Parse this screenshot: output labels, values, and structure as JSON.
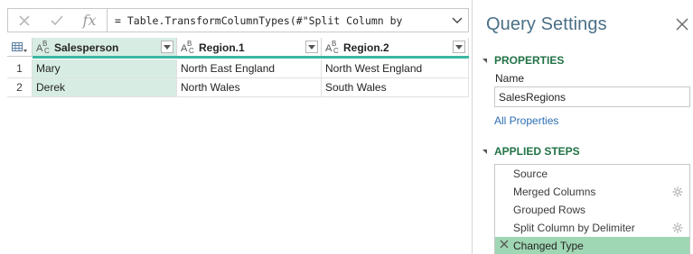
{
  "formula_bar": {
    "cancel_icon": "close-icon",
    "commit_icon": "checkmark-icon",
    "fx_label": "fx",
    "formula": "= Table.TransformColumnTypes(#\"Split Column by"
  },
  "grid": {
    "columns": [
      {
        "type_icon": "text-type-icon",
        "label": "Salesperson"
      },
      {
        "type_icon": "text-type-icon",
        "label": "Region.1"
      },
      {
        "type_icon": "text-type-icon",
        "label": "Region.2"
      }
    ],
    "rows": [
      {
        "num": "1",
        "cells": [
          "Mary",
          "North East England",
          "North West England"
        ]
      },
      {
        "num": "2",
        "cells": [
          "Derek",
          "North Wales",
          "South Wales"
        ]
      }
    ]
  },
  "settings": {
    "title": "Query Settings",
    "properties_header": "PROPERTIES",
    "name_label": "Name",
    "name_value": "SalesRegions",
    "all_properties": "All Properties",
    "applied_steps_header": "APPLIED STEPS",
    "steps": [
      {
        "label": "Source",
        "has_gear": false
      },
      {
        "label": "Merged Columns",
        "has_gear": true
      },
      {
        "label": "Grouped Rows",
        "has_gear": false
      },
      {
        "label": "Split Column by Delimiter",
        "has_gear": true
      },
      {
        "label": "Changed Type",
        "has_gear": false,
        "active": true
      }
    ]
  },
  "colors": {
    "accent_green": "#217346",
    "title_blue": "#4a6f86",
    "selected_column": "#d7ede3",
    "active_step": "#9fd6b3",
    "teal_line": "#3bb7a3",
    "link": "#2b6fb3"
  }
}
